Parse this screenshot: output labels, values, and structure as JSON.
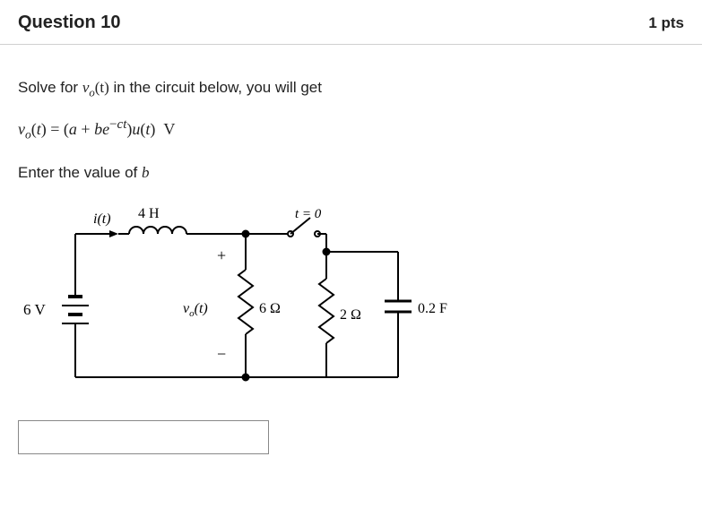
{
  "header": {
    "title": "Question 10",
    "points": "1 pts"
  },
  "prompt": {
    "line1_pre": "Solve for ",
    "line1_var": "v",
    "line1_sub": "o",
    "line1_arg": "(t)",
    "line1_post": " in the circuit below, you will get",
    "equation_html": "v_o(t) = (a + b e^{-ct}) u(t)  V",
    "line3_pre": "Enter the value of ",
    "line3_var": "b"
  },
  "circuit": {
    "source_label": "6 V",
    "current_label": "i(t)",
    "inductor_label": "4 H",
    "vo_label": "v_o(t)",
    "r1_label": "6 Ω",
    "switch_label": "t = 0",
    "r2_label": "2 Ω",
    "cap_label": "0.2 F",
    "plus": "+",
    "minus": "−"
  },
  "answer": {
    "value": "",
    "placeholder": ""
  }
}
